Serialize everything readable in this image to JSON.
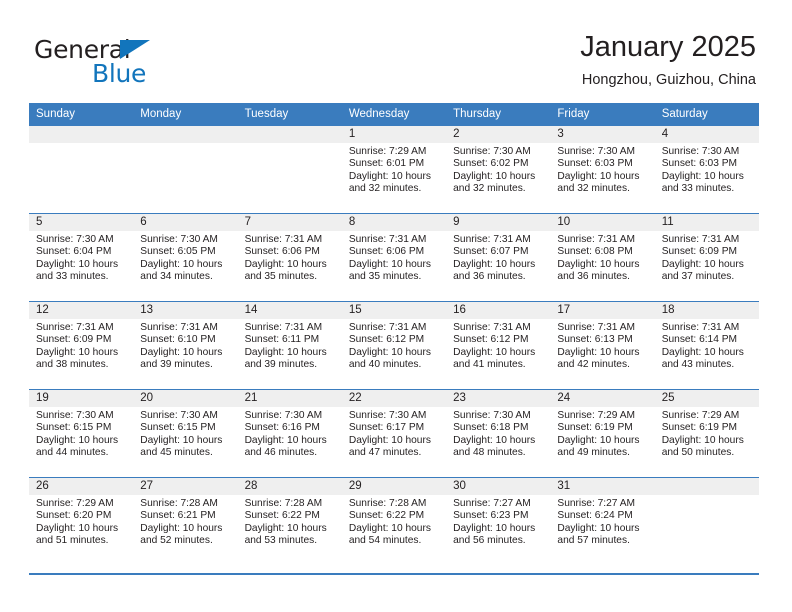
{
  "brand": {
    "name_part1": "General",
    "name_part2": "Blue",
    "triangle_icon": "triangle-icon",
    "colors": {
      "dark": "#231f20",
      "blue": "#1275bc"
    }
  },
  "header": {
    "title": "January 2025",
    "subtitle": "Hongzhou, Guizhou, China"
  },
  "calendar": {
    "header_bg": "#3a7cbe",
    "daynum_bg": "#efefef",
    "weekday_headers": [
      "Sunday",
      "Monday",
      "Tuesday",
      "Wednesday",
      "Thursday",
      "Friday",
      "Saturday"
    ],
    "weeks": [
      [
        {
          "day": "",
          "empty": true
        },
        {
          "day": "",
          "empty": true
        },
        {
          "day": "",
          "empty": true
        },
        {
          "day": "1",
          "sunrise": "Sunrise: 7:29 AM",
          "sunset": "Sunset: 6:01 PM",
          "daylight_line1": "Daylight: 10 hours",
          "daylight_line2": "and 32 minutes."
        },
        {
          "day": "2",
          "sunrise": "Sunrise: 7:30 AM",
          "sunset": "Sunset: 6:02 PM",
          "daylight_line1": "Daylight: 10 hours",
          "daylight_line2": "and 32 minutes."
        },
        {
          "day": "3",
          "sunrise": "Sunrise: 7:30 AM",
          "sunset": "Sunset: 6:03 PM",
          "daylight_line1": "Daylight: 10 hours",
          "daylight_line2": "and 32 minutes."
        },
        {
          "day": "4",
          "sunrise": "Sunrise: 7:30 AM",
          "sunset": "Sunset: 6:03 PM",
          "daylight_line1": "Daylight: 10 hours",
          "daylight_line2": "and 33 minutes."
        }
      ],
      [
        {
          "day": "5",
          "sunrise": "Sunrise: 7:30 AM",
          "sunset": "Sunset: 6:04 PM",
          "daylight_line1": "Daylight: 10 hours",
          "daylight_line2": "and 33 minutes."
        },
        {
          "day": "6",
          "sunrise": "Sunrise: 7:30 AM",
          "sunset": "Sunset: 6:05 PM",
          "daylight_line1": "Daylight: 10 hours",
          "daylight_line2": "and 34 minutes."
        },
        {
          "day": "7",
          "sunrise": "Sunrise: 7:31 AM",
          "sunset": "Sunset: 6:06 PM",
          "daylight_line1": "Daylight: 10 hours",
          "daylight_line2": "and 35 minutes."
        },
        {
          "day": "8",
          "sunrise": "Sunrise: 7:31 AM",
          "sunset": "Sunset: 6:06 PM",
          "daylight_line1": "Daylight: 10 hours",
          "daylight_line2": "and 35 minutes."
        },
        {
          "day": "9",
          "sunrise": "Sunrise: 7:31 AM",
          "sunset": "Sunset: 6:07 PM",
          "daylight_line1": "Daylight: 10 hours",
          "daylight_line2": "and 36 minutes."
        },
        {
          "day": "10",
          "sunrise": "Sunrise: 7:31 AM",
          "sunset": "Sunset: 6:08 PM",
          "daylight_line1": "Daylight: 10 hours",
          "daylight_line2": "and 36 minutes."
        },
        {
          "day": "11",
          "sunrise": "Sunrise: 7:31 AM",
          "sunset": "Sunset: 6:09 PM",
          "daylight_line1": "Daylight: 10 hours",
          "daylight_line2": "and 37 minutes."
        }
      ],
      [
        {
          "day": "12",
          "sunrise": "Sunrise: 7:31 AM",
          "sunset": "Sunset: 6:09 PM",
          "daylight_line1": "Daylight: 10 hours",
          "daylight_line2": "and 38 minutes."
        },
        {
          "day": "13",
          "sunrise": "Sunrise: 7:31 AM",
          "sunset": "Sunset: 6:10 PM",
          "daylight_line1": "Daylight: 10 hours",
          "daylight_line2": "and 39 minutes."
        },
        {
          "day": "14",
          "sunrise": "Sunrise: 7:31 AM",
          "sunset": "Sunset: 6:11 PM",
          "daylight_line1": "Daylight: 10 hours",
          "daylight_line2": "and 39 minutes."
        },
        {
          "day": "15",
          "sunrise": "Sunrise: 7:31 AM",
          "sunset": "Sunset: 6:12 PM",
          "daylight_line1": "Daylight: 10 hours",
          "daylight_line2": "and 40 minutes."
        },
        {
          "day": "16",
          "sunrise": "Sunrise: 7:31 AM",
          "sunset": "Sunset: 6:12 PM",
          "daylight_line1": "Daylight: 10 hours",
          "daylight_line2": "and 41 minutes."
        },
        {
          "day": "17",
          "sunrise": "Sunrise: 7:31 AM",
          "sunset": "Sunset: 6:13 PM",
          "daylight_line1": "Daylight: 10 hours",
          "daylight_line2": "and 42 minutes."
        },
        {
          "day": "18",
          "sunrise": "Sunrise: 7:31 AM",
          "sunset": "Sunset: 6:14 PM",
          "daylight_line1": "Daylight: 10 hours",
          "daylight_line2": "and 43 minutes."
        }
      ],
      [
        {
          "day": "19",
          "sunrise": "Sunrise: 7:30 AM",
          "sunset": "Sunset: 6:15 PM",
          "daylight_line1": "Daylight: 10 hours",
          "daylight_line2": "and 44 minutes."
        },
        {
          "day": "20",
          "sunrise": "Sunrise: 7:30 AM",
          "sunset": "Sunset: 6:15 PM",
          "daylight_line1": "Daylight: 10 hours",
          "daylight_line2": "and 45 minutes."
        },
        {
          "day": "21",
          "sunrise": "Sunrise: 7:30 AM",
          "sunset": "Sunset: 6:16 PM",
          "daylight_line1": "Daylight: 10 hours",
          "daylight_line2": "and 46 minutes."
        },
        {
          "day": "22",
          "sunrise": "Sunrise: 7:30 AM",
          "sunset": "Sunset: 6:17 PM",
          "daylight_line1": "Daylight: 10 hours",
          "daylight_line2": "and 47 minutes."
        },
        {
          "day": "23",
          "sunrise": "Sunrise: 7:30 AM",
          "sunset": "Sunset: 6:18 PM",
          "daylight_line1": "Daylight: 10 hours",
          "daylight_line2": "and 48 minutes."
        },
        {
          "day": "24",
          "sunrise": "Sunrise: 7:29 AM",
          "sunset": "Sunset: 6:19 PM",
          "daylight_line1": "Daylight: 10 hours",
          "daylight_line2": "and 49 minutes."
        },
        {
          "day": "25",
          "sunrise": "Sunrise: 7:29 AM",
          "sunset": "Sunset: 6:19 PM",
          "daylight_line1": "Daylight: 10 hours",
          "daylight_line2": "and 50 minutes."
        }
      ],
      [
        {
          "day": "26",
          "sunrise": "Sunrise: 7:29 AM",
          "sunset": "Sunset: 6:20 PM",
          "daylight_line1": "Daylight: 10 hours",
          "daylight_line2": "and 51 minutes."
        },
        {
          "day": "27",
          "sunrise": "Sunrise: 7:28 AM",
          "sunset": "Sunset: 6:21 PM",
          "daylight_line1": "Daylight: 10 hours",
          "daylight_line2": "and 52 minutes."
        },
        {
          "day": "28",
          "sunrise": "Sunrise: 7:28 AM",
          "sunset": "Sunset: 6:22 PM",
          "daylight_line1": "Daylight: 10 hours",
          "daylight_line2": "and 53 minutes."
        },
        {
          "day": "29",
          "sunrise": "Sunrise: 7:28 AM",
          "sunset": "Sunset: 6:22 PM",
          "daylight_line1": "Daylight: 10 hours",
          "daylight_line2": "and 54 minutes."
        },
        {
          "day": "30",
          "sunrise": "Sunrise: 7:27 AM",
          "sunset": "Sunset: 6:23 PM",
          "daylight_line1": "Daylight: 10 hours",
          "daylight_line2": "and 56 minutes."
        },
        {
          "day": "31",
          "sunrise": "Sunrise: 7:27 AM",
          "sunset": "Sunset: 6:24 PM",
          "daylight_line1": "Daylight: 10 hours",
          "daylight_line2": "and 57 minutes."
        },
        {
          "day": "",
          "empty": true
        }
      ]
    ]
  }
}
